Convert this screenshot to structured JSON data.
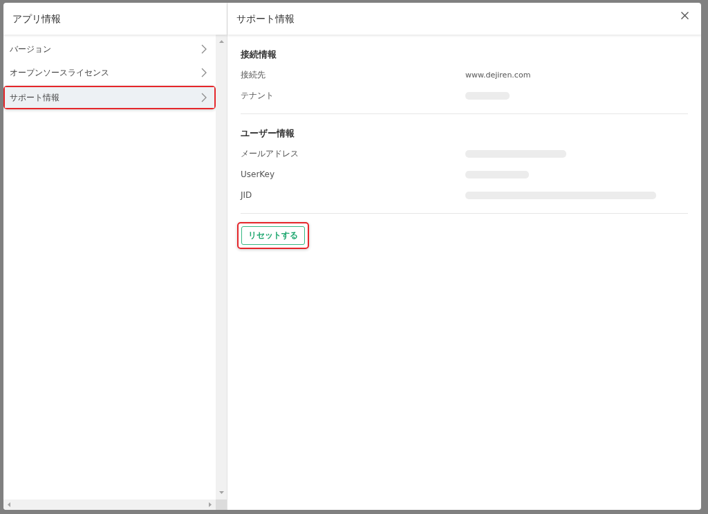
{
  "sidebar": {
    "title": "アプリ情報",
    "items": [
      {
        "label": "バージョン",
        "selected": false,
        "annotated": false
      },
      {
        "label": "オープンソースライセンス",
        "selected": false,
        "annotated": false
      },
      {
        "label": "サポート情報",
        "selected": true,
        "annotated": true
      }
    ]
  },
  "panel": {
    "title": "サポート情報",
    "sections": [
      {
        "heading": "接続情報",
        "rows": [
          {
            "label": "接続先",
            "kind": "text",
            "value": "www.dejiren.com"
          },
          {
            "label": "テナント",
            "kind": "blurred"
          }
        ]
      },
      {
        "heading": "ユーザー情報",
        "rows": [
          {
            "label": "メールアドレス",
            "kind": "blurred"
          },
          {
            "label": "UserKey",
            "kind": "blurred"
          },
          {
            "label": "JID",
            "kind": "blurred"
          }
        ]
      }
    ],
    "reset_button": {
      "label": "リセットする",
      "annotated": true
    }
  }
}
